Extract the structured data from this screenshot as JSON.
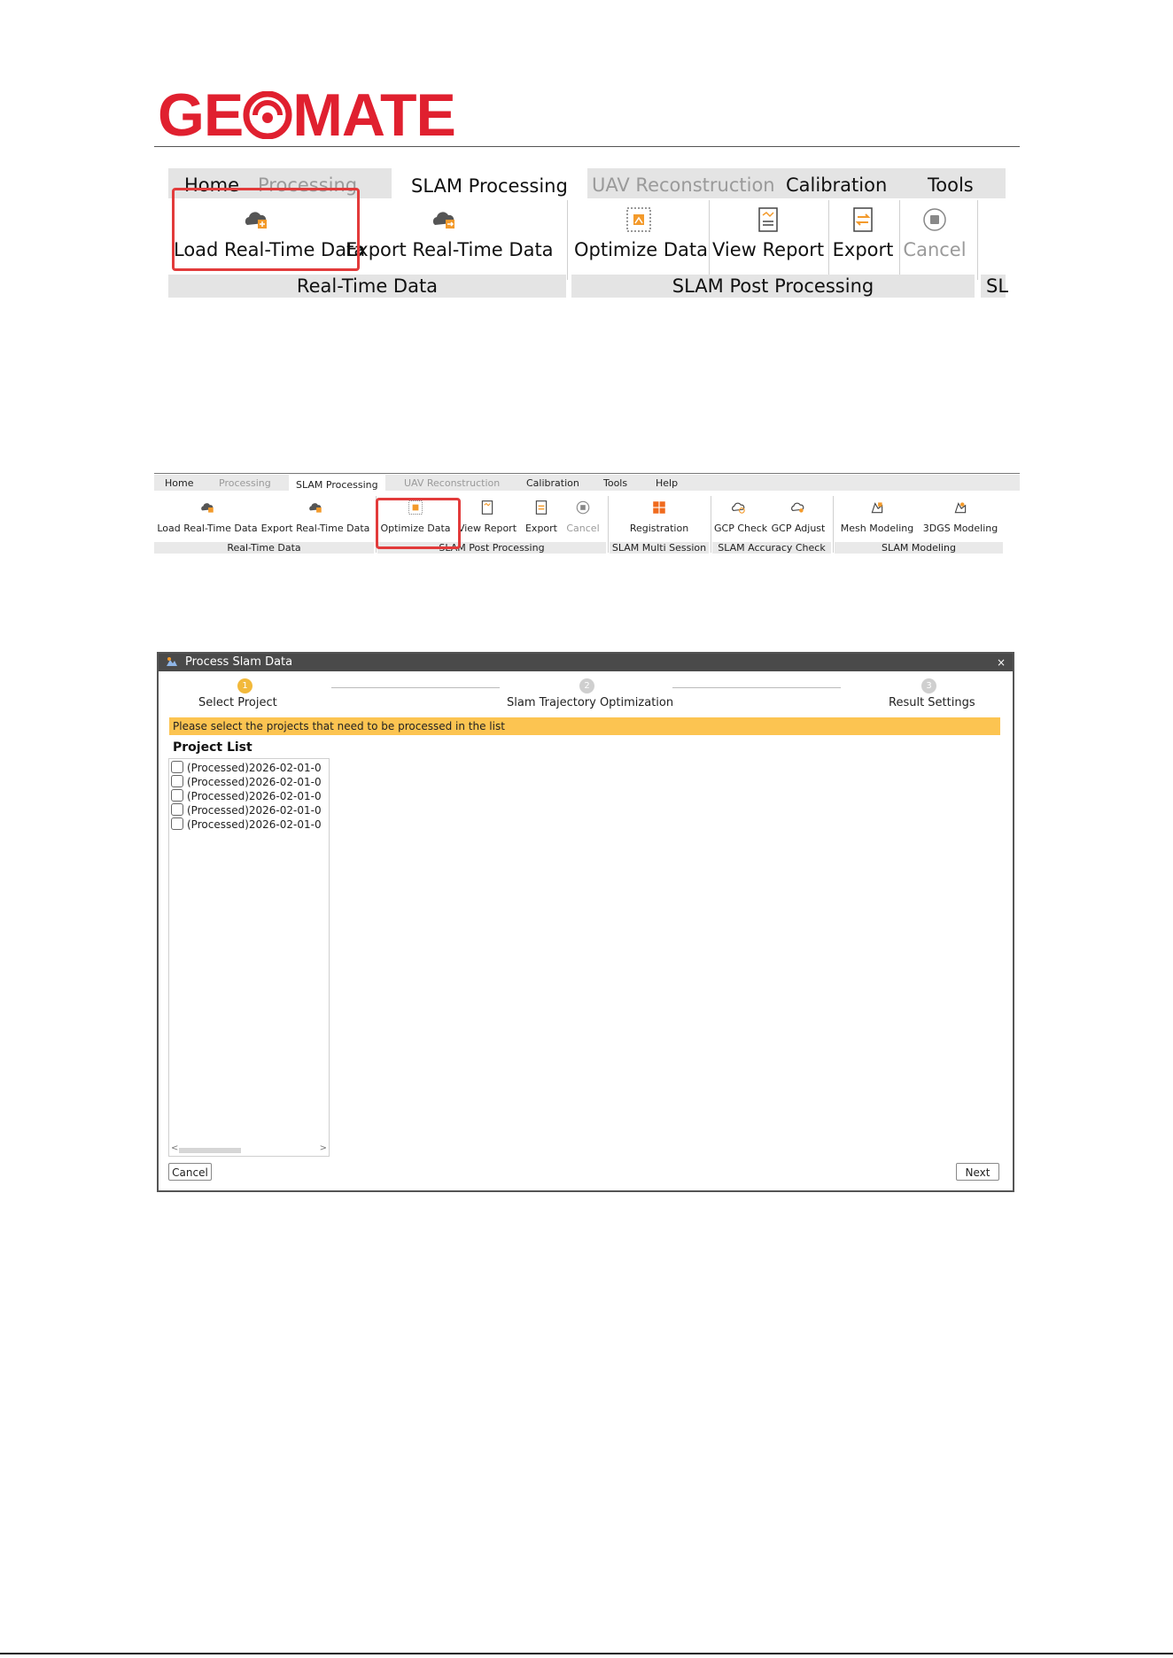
{
  "brand": {
    "logo_text_left": "GE",
    "logo_text_right": "MATE",
    "color": "#e0202f"
  },
  "ribbon_large": {
    "tabs": [
      {
        "label": "Home",
        "state": "normal"
      },
      {
        "label": "Processing",
        "state": "disabled"
      },
      {
        "label": "SLAM Processing",
        "state": "active"
      },
      {
        "label": "UAV Reconstruction",
        "state": "disabled"
      },
      {
        "label": "Calibration",
        "state": "normal"
      },
      {
        "label": "Tools",
        "state": "normal"
      }
    ],
    "buttons": [
      {
        "label": "Load Real-Time Data",
        "icon": "cloud-import-icon"
      },
      {
        "label": "Export Real-Time Data",
        "icon": "cloud-export-icon"
      },
      {
        "label": "Optimize Data",
        "icon": "optimize-icon"
      },
      {
        "label": "View Report",
        "icon": "report-icon"
      },
      {
        "label": "Export",
        "icon": "export-icon"
      },
      {
        "label": "Cancel",
        "icon": "stop-icon",
        "state": "disabled"
      }
    ],
    "groups": [
      "Real-Time Data",
      "SLAM Post Processing",
      "SL"
    ],
    "highlight_color": "#e23b3b"
  },
  "ribbon_small": {
    "tabs": [
      {
        "label": "Home",
        "state": "normal"
      },
      {
        "label": "Processing",
        "state": "disabled"
      },
      {
        "label": "SLAM Processing",
        "state": "active"
      },
      {
        "label": "UAV Reconstruction",
        "state": "disabled"
      },
      {
        "label": "Calibration",
        "state": "normal"
      },
      {
        "label": "Tools",
        "state": "normal"
      },
      {
        "label": "Help",
        "state": "normal"
      }
    ],
    "buttons": [
      {
        "label": "Load Real-Time Data",
        "icon": "cloud-import-icon"
      },
      {
        "label": "Export Real-Time Data",
        "icon": "cloud-export-icon"
      },
      {
        "label": "Optimize Data",
        "icon": "optimize-icon"
      },
      {
        "label": "View Report",
        "icon": "report-icon"
      },
      {
        "label": "Export",
        "icon": "export-icon"
      },
      {
        "label": "Cancel",
        "icon": "stop-icon",
        "state": "disabled"
      },
      {
        "label": "Registration",
        "icon": "registration-icon"
      },
      {
        "label": "GCP Check",
        "icon": "gcp-check-icon"
      },
      {
        "label": "GCP Adjust",
        "icon": "gcp-adjust-icon"
      },
      {
        "label": "Mesh Modeling",
        "icon": "mesh-modeling-icon"
      },
      {
        "label": "3DGS Modeling",
        "icon": "3dgs-modeling-icon"
      }
    ],
    "groups": [
      "Real-Time Data",
      "SLAM Post Processing",
      "SLAM Multi Session",
      "SLAM Accuracy Check",
      "SLAM Modeling"
    ]
  },
  "dialog": {
    "title": "Process Slam Data",
    "close_symbol": "×",
    "steps": [
      {
        "number": "1",
        "label": "Select Project",
        "active": true
      },
      {
        "number": "2",
        "label": "Slam Trajectory Optimization",
        "active": false
      },
      {
        "number": "3",
        "label": "Result Settings",
        "active": false
      }
    ],
    "banner": "Please select the projects that need to be processed in the list",
    "banner_color": "#fcc451",
    "project_list_title": "Project List",
    "projects": [
      "(Processed)2026-02-01-0",
      "(Processed)2026-02-01-0",
      "(Processed)2026-02-01-0",
      "(Processed)2026-02-01-0",
      "(Processed)2026-02-01-0"
    ],
    "scroll_left": "<",
    "scroll_right": ">",
    "cancel_label": "Cancel",
    "next_label": "Next"
  }
}
